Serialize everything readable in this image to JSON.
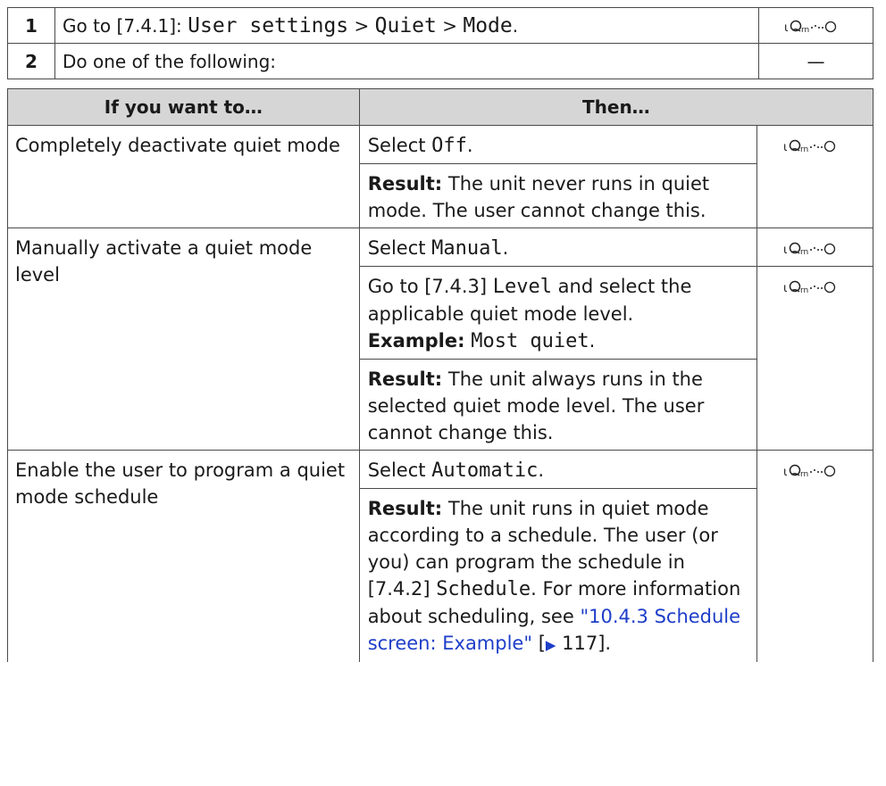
{
  "steps": [
    {
      "num": "1",
      "prefix": "Go to [7.4.1]: ",
      "path_a": "User settings",
      "sep1": " > ",
      "path_b": "Quiet",
      "sep2": " > ",
      "path_c": "Mode",
      "suffix": ".",
      "icon": "remote-controller-icon"
    },
    {
      "num": "2",
      "text": "Do one of the following:",
      "right": "—"
    }
  ],
  "table": {
    "headers": [
      "If you want to…",
      "Then…"
    ],
    "rows": [
      {
        "want": "Completely deactivate quiet mode",
        "actions": [
          {
            "pre": "Select ",
            "code": "Off",
            "post": ".",
            "icon": "remote-controller-icon"
          },
          {
            "label": "Result:",
            "text": " The unit never runs in quiet mode. The user cannot change this."
          }
        ]
      },
      {
        "want": "Manually activate a quiet mode level",
        "actions": [
          {
            "pre": "Select ",
            "code": "Manual",
            "post": ".",
            "icon": "remote-controller-icon"
          },
          {
            "pre": "Go to [7.4.3] ",
            "code": "Level",
            "post": " and select the applicable quiet mode level.",
            "ex_label": "Example:",
            "ex_code": "Most quiet",
            "ex_post": ".",
            "icon": "remote-controller-icon"
          },
          {
            "label": "Result:",
            "text": " The unit always runs in the selected quiet mode level. The user cannot change this."
          }
        ]
      },
      {
        "want": "Enable the user to program a quiet mode schedule",
        "actions": [
          {
            "pre": "Select ",
            "code": "Automatic",
            "post": ".",
            "icon": "remote-controller-icon"
          },
          {
            "label": "Result:",
            "text": " The unit runs in quiet mode according to a schedule. The user (or you) can program the schedule in [7.4.2] ",
            "code": "Schedule",
            "text2": ". For more information about scheduling, see ",
            "link": "\"10.4.3 Schedule screen: Example\"",
            "ref_open": " [",
            "ref_arrow": "▶",
            "ref_page": " 117",
            "ref_close": "]."
          }
        ]
      }
    ]
  },
  "colors": {
    "link": "#1e3ec9",
    "header_bg": "#d6d6d6",
    "border": "#4a4a4a"
  }
}
